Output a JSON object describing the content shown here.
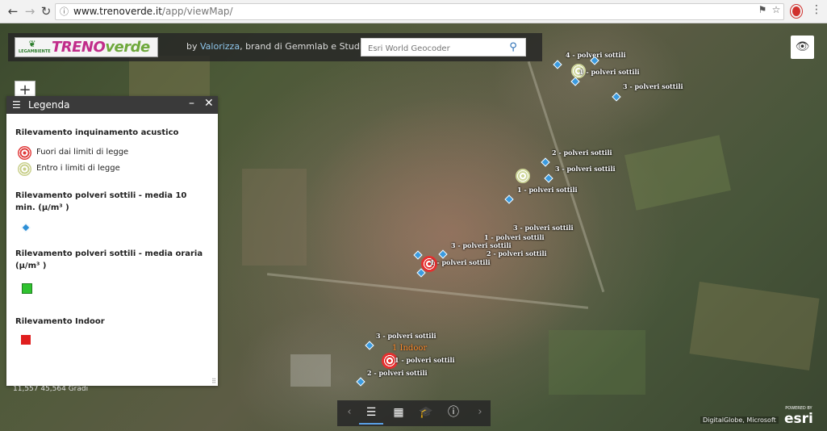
{
  "browser": {
    "url_host": "www.trenoverde.it",
    "url_path": "/app/viewMap/"
  },
  "banner": {
    "logo_org": "LEGAMBIENTE",
    "logo_title_1": "TRENO",
    "logo_title_2": "verde",
    "by_prefix": "by ",
    "by_link": "Valorizza",
    "by_suffix": ", brand di Gemmlab e StudioSMA",
    "geocoder_placeholder": "Esri World Geocoder"
  },
  "legend": {
    "title": "Legenda",
    "sections": {
      "acoustic": {
        "title": "Rilevamento inquinamento acustico",
        "items": [
          "Fuori dai limiti di legge",
          "Entro i limiti di legge"
        ]
      },
      "pm10min": {
        "title": "Rilevamento polveri sottili - media 10 min. (μ/m³ )"
      },
      "pmhourly": {
        "title": "Rilevamento polveri sottili - media oraria (μ/m³ )"
      },
      "indoor": {
        "title": "Rilevamento Indoor"
      }
    }
  },
  "map": {
    "coords": "11,557 45,564 Gradi",
    "labels": [
      "4 - polveri sottili",
      "1 - polveri sottili",
      "3 - polveri sottili",
      "2 - polveri sottili",
      "3 - polveri sottili",
      "1 - polveri sottili",
      "3 - polveri sottili",
      "1 - polveri sottili",
      "3 - polveri sottili",
      "2 - polveri sottili",
      "1 - polveri sottili",
      "3 - polveri sottili",
      "1 - polveri sottili",
      "2 - polveri sottili"
    ],
    "indoor_label": "1 Indoor",
    "attribution": "DigitalGlobe, Microsoft",
    "esri_powered": "POWERED BY",
    "esri_name": "esri"
  },
  "icons": {
    "back": "arrow-left-icon",
    "forward": "arrow-right-icon",
    "reload": "reload-icon",
    "lock": "info-icon",
    "visibility": "eye-icon",
    "zoom": "plus-icon",
    "legend_list": "list-icon",
    "basemap": "grid-icon",
    "measure": "graduation-cap-icon",
    "about": "info-icon"
  },
  "colors": {
    "exceeded": "#e03a3a",
    "within": "#c8cf8a",
    "pm10min": "#2d8fd6",
    "pmhourly": "#2fc22f",
    "indoor": "#e01e1e"
  }
}
